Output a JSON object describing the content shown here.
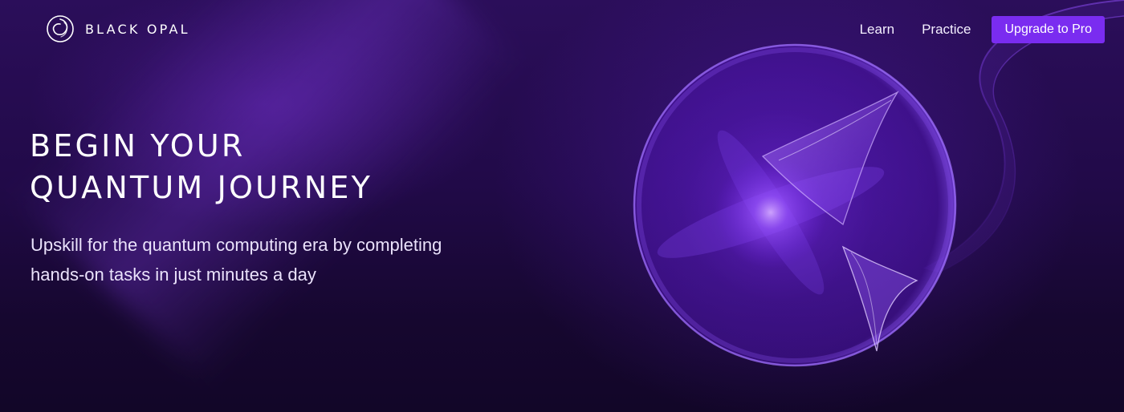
{
  "brand": {
    "name": "BLACK OPAL",
    "logo_icon": "opal-swirl-icon"
  },
  "nav": {
    "links": [
      {
        "label": "Learn"
      },
      {
        "label": "Practice"
      }
    ],
    "cta_label": "Upgrade to Pro"
  },
  "hero": {
    "headline_line1": "BEGIN YOUR",
    "headline_line2": "QUANTUM JOURNEY",
    "subtext_line1": "Upskill for the quantum computing era by completing",
    "subtext_line2": "hands-on tasks in just minutes a day",
    "visual_icon": "quantum-orb-icon"
  },
  "colors": {
    "background": "#210a48",
    "accent": "#7a2cf0",
    "text": "#ffffff"
  }
}
